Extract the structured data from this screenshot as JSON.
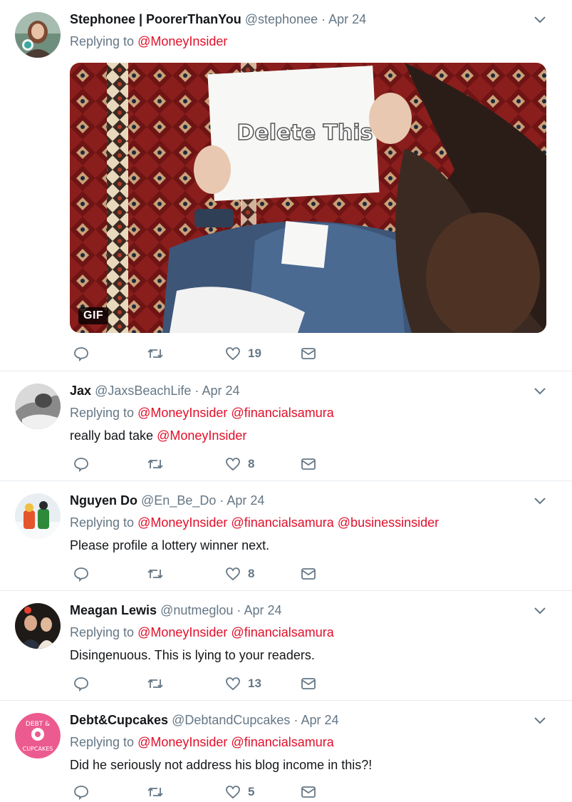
{
  "colors": {
    "mention": "#e0102a",
    "muted": "#657786",
    "divider": "#e6ecf0"
  },
  "icons": {
    "reply": "reply-icon",
    "retweet": "retweet-icon",
    "like": "heart-icon",
    "dm": "envelope-icon",
    "menu": "chevron-down-icon"
  },
  "tweets": [
    {
      "display_name": "Stephonee | PoorerThanYou",
      "handle": "@stephonee",
      "separator": "·",
      "date": "Apr 24",
      "replying_prefix": "Replying to",
      "mentions": [
        "@MoneyInsider"
      ],
      "text": "",
      "media": {
        "type": "gif",
        "badge": "GIF",
        "caption": "Delete This"
      },
      "likes": "19"
    },
    {
      "display_name": "Jax",
      "handle": "@JaxsBeachLife",
      "separator": "·",
      "date": "Apr 24",
      "replying_prefix": "Replying to",
      "mentions": [
        "@MoneyInsider",
        "@financialsamura"
      ],
      "text": "really bad take ",
      "text_mention": "@MoneyInsider",
      "likes": "8"
    },
    {
      "display_name": "Nguyen Do",
      "handle": "@En_Be_Do",
      "separator": "·",
      "date": "Apr 24",
      "replying_prefix": "Replying to",
      "mentions": [
        "@MoneyInsider",
        "@financialsamura",
        "@businessinsider"
      ],
      "text": "Please profile a lottery winner next.",
      "likes": "8"
    },
    {
      "display_name": "Meagan Lewis",
      "handle": "@nutmeglou",
      "separator": "·",
      "date": "Apr 24",
      "replying_prefix": "Replying to",
      "mentions": [
        "@MoneyInsider",
        "@financialsamura"
      ],
      "text": "Disingenuous. This is lying to your readers.",
      "likes": "13"
    },
    {
      "display_name": "Debt&Cupcakes",
      "handle": "@DebtandCupcakes",
      "separator": "·",
      "date": "Apr 24",
      "replying_prefix": "Replying to",
      "mentions": [
        "@MoneyInsider",
        "@financialsamura"
      ],
      "text": "Did he seriously not address his blog income in this?!",
      "avatar_text": [
        "DEBT &",
        "CUPCAKES"
      ],
      "likes": "5"
    }
  ]
}
